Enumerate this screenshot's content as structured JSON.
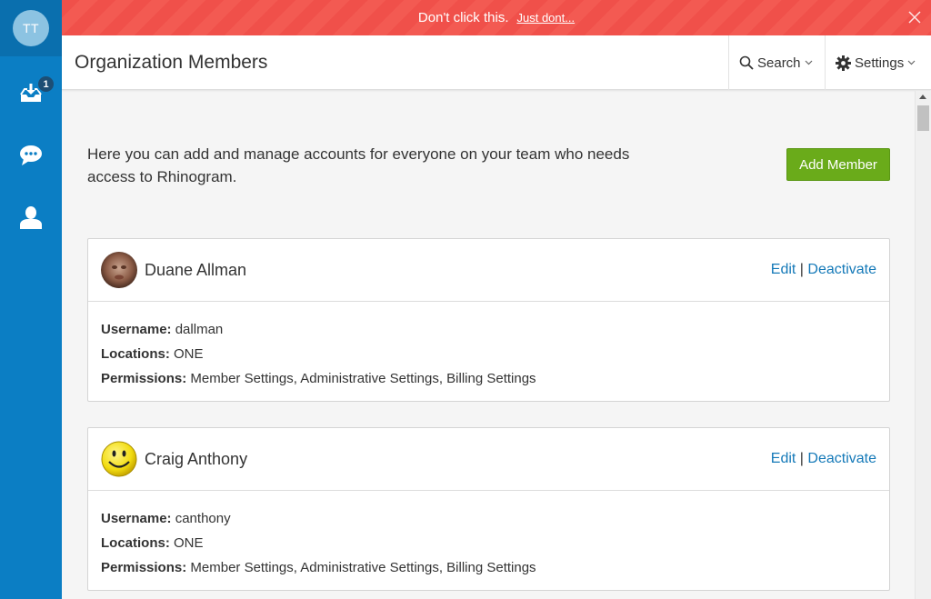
{
  "sidebar": {
    "user_initials": "TT",
    "inbox_badge": "1",
    "items": [
      {
        "name": "inbox",
        "icon": "inbox-download-icon"
      },
      {
        "name": "chat",
        "icon": "chat-bubble-icon"
      },
      {
        "name": "contacts",
        "icon": "user-icon"
      }
    ],
    "color": "#0b7ec4"
  },
  "banner": {
    "message": "Don't click this.",
    "link_text": "Just dont...",
    "color": "#f0504a"
  },
  "header": {
    "title": "Organization Members",
    "search_label": "Search",
    "settings_label": "Settings"
  },
  "main": {
    "intro_text": "Here you can add and manage accounts for everyone on your team who needs access to Rhinogram.",
    "add_button_label": "Add Member",
    "add_button_color": "#6aab1a",
    "members": [
      {
        "name": "Duane Allman",
        "edit_label": "Edit",
        "separator": "|",
        "deactivate_label": "Deactivate",
        "username_label": "Username:",
        "username": "dallman",
        "locations_label": "Locations:",
        "locations": "ONE",
        "permissions_label": "Permissions:",
        "permissions": "Member Settings, Administrative Settings, Billing Settings"
      },
      {
        "name": "Craig Anthony",
        "edit_label": "Edit",
        "separator": "|",
        "deactivate_label": "Deactivate",
        "username_label": "Username:",
        "username": "canthony",
        "locations_label": "Locations:",
        "locations": "ONE",
        "permissions_label": "Permissions:",
        "permissions": "Member Settings, Administrative Settings, Billing Settings"
      }
    ]
  }
}
